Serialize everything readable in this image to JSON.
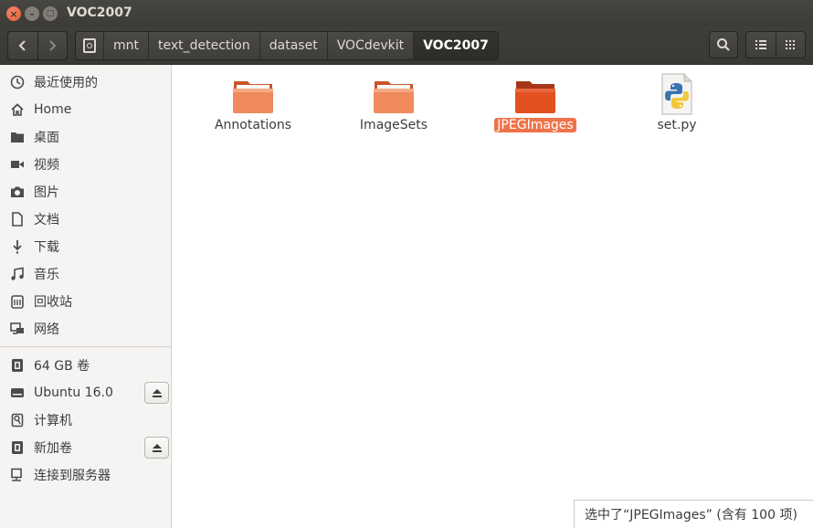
{
  "window": {
    "title": "VOC2007"
  },
  "header": {
    "path": [
      "mnt",
      "text_detection",
      "dataset",
      "VOCdevkit",
      "VOC2007"
    ]
  },
  "sidebar": {
    "places": [
      {
        "label": "最近使用的",
        "icon": "clock-icon"
      },
      {
        "label": "Home",
        "icon": "home-icon"
      },
      {
        "label": "桌面",
        "icon": "desktop-folder-icon"
      },
      {
        "label": "视频",
        "icon": "video-icon"
      },
      {
        "label": "图片",
        "icon": "camera-icon"
      },
      {
        "label": "文档",
        "icon": "document-icon"
      },
      {
        "label": "下载",
        "icon": "download-icon"
      },
      {
        "label": "音乐",
        "icon": "music-icon"
      },
      {
        "label": "回收站",
        "icon": "trash-icon"
      },
      {
        "label": "网络",
        "icon": "network-icon"
      }
    ],
    "devices": [
      {
        "label": "64 GB 卷",
        "icon": "drive-icon",
        "eject": false
      },
      {
        "label": "Ubuntu 16.0",
        "icon": "harddisk-icon",
        "eject": true
      },
      {
        "label": "计算机",
        "icon": "computer-icon",
        "eject": false
      },
      {
        "label": "新加卷",
        "icon": "drive-icon",
        "eject": true
      },
      {
        "label": "连接到服务器",
        "icon": "server-icon",
        "eject": false
      }
    ]
  },
  "files": [
    {
      "name": "Annotations",
      "type": "folder",
      "selected": false
    },
    {
      "name": "ImageSets",
      "type": "folder",
      "selected": false
    },
    {
      "name": "JPEGImages",
      "type": "folder",
      "selected": true
    },
    {
      "name": "set.py",
      "type": "python-file",
      "selected": false
    }
  ],
  "status": {
    "text": "选中了“JPEGImages” (含有 100 项)"
  },
  "colors": {
    "accent": "#ef7349",
    "titlebar": "#3c3b37",
    "folder": "#f08a5d"
  }
}
